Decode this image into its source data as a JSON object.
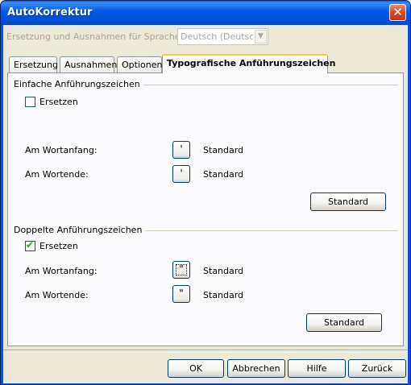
{
  "window": {
    "title": "AutoKorrektur",
    "close": "✕"
  },
  "language": {
    "label": "Ersetzung und Ausnahmen für Sprache:",
    "value": "Deutsch (Deutschland)",
    "arrow": "▼"
  },
  "tabs": [
    {
      "label": "Ersetzung"
    },
    {
      "label": "Ausnahmen"
    },
    {
      "label": "Optionen"
    },
    {
      "label": "Typografische Anführungszeichen"
    }
  ],
  "single": {
    "group_label": "Einfache Anführungszeichen",
    "replace_label": "Ersetzen",
    "replace_checked": false,
    "start_label": "Am Wortanfang:",
    "start_char": "'",
    "start_value": "Standard",
    "end_label": "Am Wortende:",
    "end_char": "'",
    "end_value": "Standard",
    "default_button": "Standard"
  },
  "double": {
    "group_label": "Doppelte Anführungszeichen",
    "replace_label": "Ersetzen",
    "replace_checked": true,
    "check_mark": "✔",
    "start_label": "Am Wortanfang:",
    "start_char": "\"",
    "start_value": "Standard",
    "end_label": "Am Wortende:",
    "end_char": "\"",
    "end_value": "Standard",
    "default_button": "Standard"
  },
  "footer": {
    "ok": "OK",
    "cancel": "Abbrechen",
    "help": "Hilfe",
    "reset": "Zurück"
  }
}
